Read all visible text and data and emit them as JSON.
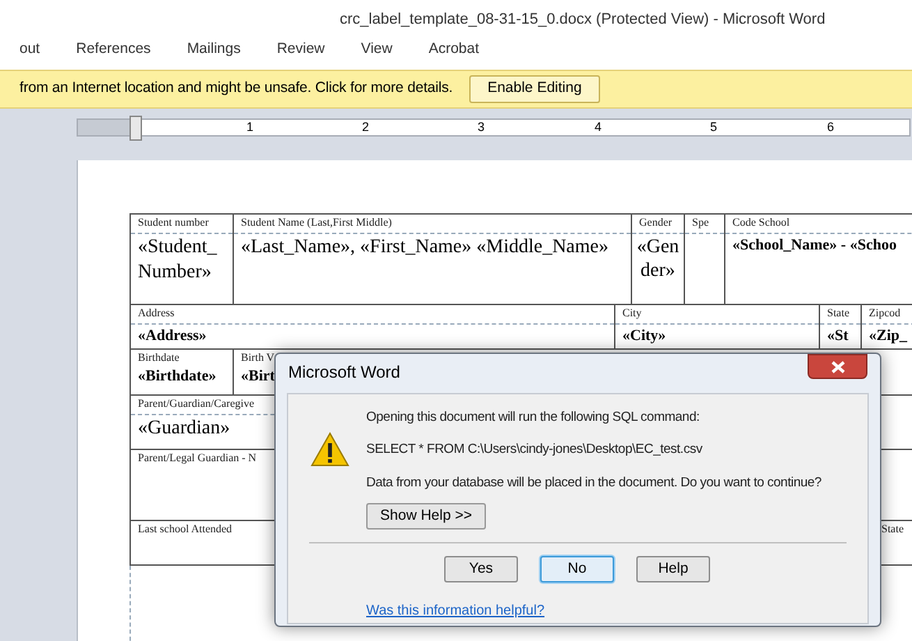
{
  "window": {
    "title": "crc_label_template_08-31-15_0.docx (Protected View)  -  Microsoft Word"
  },
  "ribbon_tabs": [
    {
      "label": "out"
    },
    {
      "label": "References"
    },
    {
      "label": "Mailings"
    },
    {
      "label": "Review"
    },
    {
      "label": "View"
    },
    {
      "label": "Acrobat"
    }
  ],
  "message_bar": {
    "text": "from an Internet location and might be unsafe. Click for more details.",
    "button": "Enable Editing"
  },
  "ruler": {
    "labels": [
      "1",
      "2",
      "3",
      "4",
      "5",
      "6"
    ]
  },
  "document": {
    "sections": [
      {
        "fields": [
          {
            "label": "Student number",
            "value": "«Student_Number»",
            "kind": "large"
          },
          {
            "label": "Student Name  (Last,First Middle)",
            "value": "«Last_Name», «First_Name» «Middle_Name»",
            "kind": "large"
          },
          {
            "label": "Gender",
            "value": "«Gender»",
            "kind": "narrow"
          },
          {
            "label": "Spe"
          },
          {
            "label": "Code School",
            "value": "«School_Name» - «Schoo",
            "kind": "bold"
          }
        ]
      },
      {
        "fields": [
          {
            "label": "Address",
            "value": "«Address»",
            "kind": "bold"
          },
          {
            "label": "City",
            "value": "«City»",
            "kind": "bold"
          },
          {
            "label": "State",
            "value": "«St",
            "kind": "bold"
          },
          {
            "label": "Zipcod",
            "value": "«Zip_",
            "kind": "bold"
          }
        ]
      },
      {
        "fields": [
          {
            "label": "Birthdate",
            "value": "«Birthdate»",
            "kind": "bold"
          },
          {
            "label": "Birth V",
            "value": "«Birt",
            "kind": "bold"
          }
        ]
      },
      {
        "fields": [
          {
            "label": "Parent/Guardian/Caregive",
            "value": "«Guardian»",
            "kind": "large"
          }
        ]
      },
      {
        "fields": [
          {
            "label": "Parent/Legal Guardian - N"
          }
        ]
      },
      {
        "fields": [
          {
            "label": "Last school Attended"
          },
          {
            "label": "State"
          }
        ]
      }
    ]
  },
  "dialog": {
    "title": "Microsoft Word",
    "lines": [
      "Opening this document will run the following SQL command:",
      "SELECT * FROM C:\\Users\\cindy-jones\\Desktop\\EC_test.csv",
      "Data from your database will be placed in the document. Do you want to continue?"
    ],
    "help_toggle": "Show Help >>",
    "buttons": [
      {
        "label": "Yes",
        "default": false
      },
      {
        "label": "No",
        "default": true
      },
      {
        "label": "Help",
        "default": false
      }
    ],
    "link": "Was this information helpful?"
  }
}
